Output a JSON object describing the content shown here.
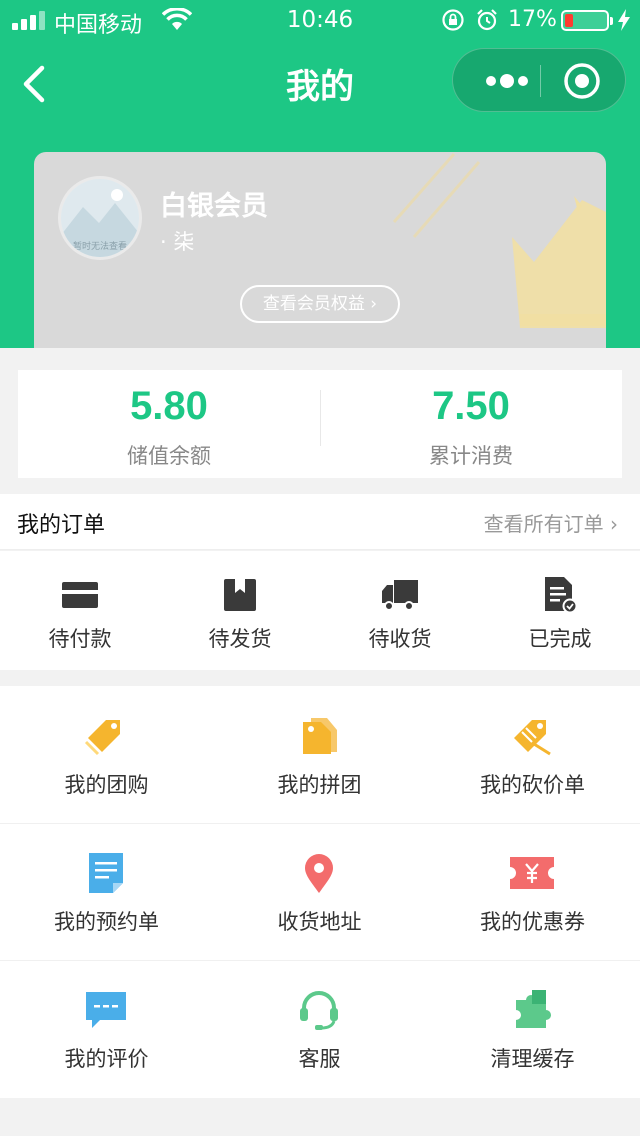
{
  "status_bar": {
    "carrier": "中国移动",
    "time": "10:46",
    "battery": "17%"
  },
  "nav": {
    "title": "我的"
  },
  "member": {
    "avatar_caption": "暂时无法查看",
    "level": "白银会员",
    "name": "· 柒",
    "benefits_label": "查看会员权益 ›"
  },
  "balance": {
    "stored_value": "5.80",
    "stored_value_label": "储值余额",
    "total_spent": "7.50",
    "total_spent_label": "累计消费"
  },
  "orders": {
    "title": "我的订单",
    "view_all": "查看所有订单 ›",
    "items": [
      {
        "label": "待付款",
        "icon": "card-icon"
      },
      {
        "label": "待发货",
        "icon": "package-icon"
      },
      {
        "label": "待收货",
        "icon": "truck-icon"
      },
      {
        "label": "已完成",
        "icon": "document-check-icon"
      }
    ]
  },
  "features": {
    "items": [
      {
        "label": "我的团购",
        "icon": "tag-icon"
      },
      {
        "label": "我的拼团",
        "icon": "double-tag-icon"
      },
      {
        "label": "我的砍价单",
        "icon": "cut-tag-icon"
      },
      {
        "label": "我的预约单",
        "icon": "note-icon"
      },
      {
        "label": "收货地址",
        "icon": "location-pin-icon"
      },
      {
        "label": "我的优惠券",
        "icon": "coupon-icon"
      },
      {
        "label": "我的评价",
        "icon": "chat-bubble-icon"
      },
      {
        "label": "客服",
        "icon": "headset-icon"
      },
      {
        "label": "清理缓存",
        "icon": "puzzle-icon"
      }
    ]
  },
  "colors": {
    "brand_green": "#1dc785",
    "tag_yellow": "#f5b52e",
    "note_blue": "#4aaee9",
    "pin_red": "#f36c6c",
    "headset_green": "#5cc98b"
  }
}
